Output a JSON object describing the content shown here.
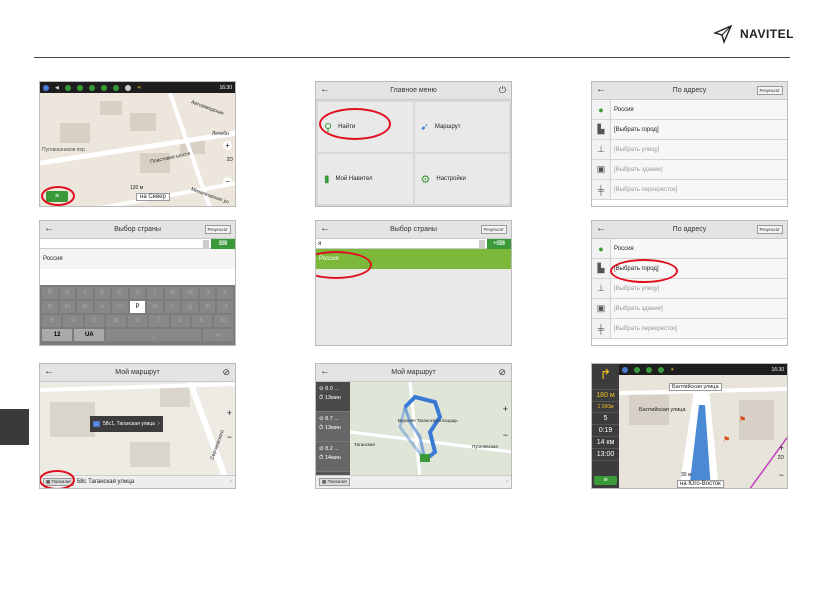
{
  "brand": {
    "logo_text": "NAVITEL"
  },
  "panel1": {
    "clock": "16:30",
    "labels": [
      "Автозаводская",
      "Пуговишников пер.",
      "Пластовое шоссе",
      "Лечебн",
      "Михалковская ул"
    ],
    "dist": "120 м",
    "dir": "на Север",
    "zoom_label": "2D"
  },
  "panel2": {
    "title": "Главное меню",
    "items": [
      "Найти",
      "Маршрут",
      "Мой Навител",
      "Настройки"
    ]
  },
  "panel3": {
    "title": "По адресу",
    "button": "Результат",
    "rows": [
      "Россия",
      "[Выбрать город]",
      "[Выбрать улицу]",
      "[Выбрать здание]",
      "[Выбрать перекресток]"
    ]
  },
  "panel4": {
    "title": "Выбор страны",
    "button": "Результат",
    "result": "Россия",
    "row1": [
      "Й",
      "Ц",
      "У",
      "К",
      "Е",
      "Н",
      "Г",
      "Ш",
      "Щ",
      "З",
      "Х"
    ],
    "row2": [
      "Ф",
      "Ы",
      "В",
      "А",
      "П",
      "Р",
      "О",
      "Л",
      "Д",
      "Ж",
      "Э"
    ],
    "row3": [
      "Я",
      "Ч",
      "С",
      "М",
      "И",
      "Т",
      "Ь",
      "Б",
      "Ю"
    ],
    "num_key": "12",
    "lang_key": "UA",
    "active_key": "Р"
  },
  "panel5": {
    "title": "Выбор страны",
    "button": "Результат",
    "query": "я",
    "result": "Россия"
  },
  "panel6": {
    "title": "По адресу",
    "button": "Результат",
    "rows": [
      "Россия",
      "[Выбрать город]",
      "[Выбрать улицу]",
      "[Выбрать здание]",
      "[Выбрать перекресток]"
    ]
  },
  "panel7": {
    "title": "Мой маршрут",
    "popup": "58с1, Таганская улица",
    "start_btn": "Поехали!",
    "address": "58с Таганская улица",
    "street_label": "Сергиевского"
  },
  "panel8": {
    "title": "Мой маршрут",
    "routes": [
      {
        "dist": "8.0 ...",
        "time": "13мин"
      },
      {
        "dist": "8.7 ...",
        "time": "13мин"
      },
      {
        "dist": "8.2 ...",
        "time": "14мин"
      }
    ],
    "start_btn": "Поехали!",
    "labels": [
      "Верхняя Таганская площадь",
      "Таганская",
      "Пугачёвская"
    ]
  },
  "panel9": {
    "clock": "16:30",
    "street_top": "Балтийская улица",
    "street_mid": "Балтийская улица",
    "dist1": "180 м",
    "dist2": "1 260м",
    "speed": "5",
    "time_left": "0:19",
    "dist_left": "14 км",
    "arrival": "13:00",
    "scale": "30 м",
    "dir": "на Юго-Восток",
    "zoom_label": "2D"
  }
}
